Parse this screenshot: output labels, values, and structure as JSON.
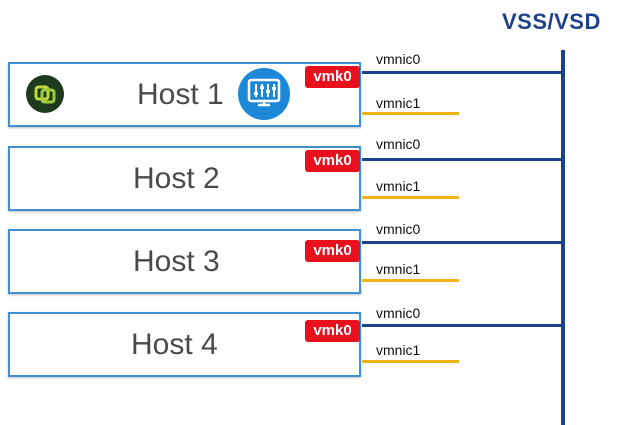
{
  "switch": {
    "title": "VSS/VSD"
  },
  "hosts": [
    {
      "label": "Host 1",
      "vmk": "vmk0",
      "nic0": "vmnic0",
      "nic1": "vmnic1"
    },
    {
      "label": "Host 2",
      "vmk": "vmk0",
      "nic0": "vmnic0",
      "nic1": "vmnic1"
    },
    {
      "label": "Host 3",
      "vmk": "vmk0",
      "nic0": "vmnic0",
      "nic1": "vmnic1"
    },
    {
      "label": "Host 4",
      "vmk": "vmk0",
      "nic0": "vmnic0",
      "nic1": "vmnic1"
    }
  ],
  "icons": {
    "vsphere_logo": "vsphere-logo-icon",
    "monitor_sliders": "monitor-sliders-icon"
  },
  "colors": {
    "switch_blue": "#1d428a",
    "host_border": "#3f8fd2",
    "vmk_red": "#e8101d",
    "standby_yellow": "#f2b21a"
  }
}
